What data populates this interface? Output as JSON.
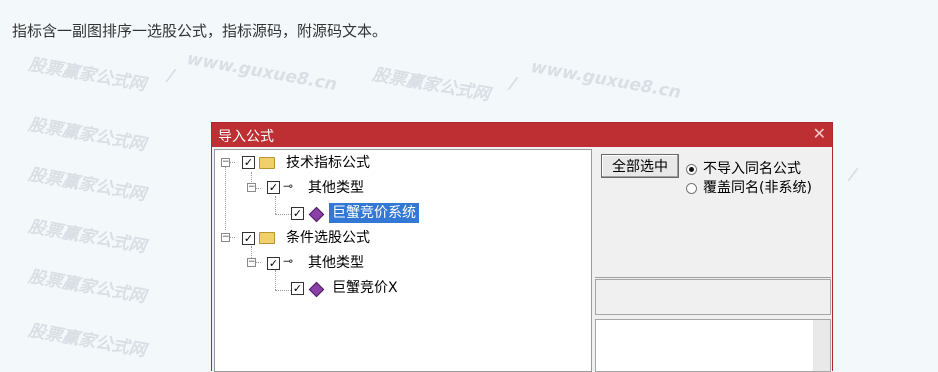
{
  "intro_text": "指标含一副图排序一选股公式，指标源码，附源码文本。",
  "watermark": {
    "brand": "股票赢家公式网",
    "slash": "/",
    "url": "www.guxue8.cn"
  },
  "dialog": {
    "title": "导入公式",
    "close_glyph": "✕",
    "tree": [
      {
        "label": "技术指标公式",
        "level": 0,
        "icon": "folder-icon",
        "checked": true,
        "expander": "−"
      },
      {
        "label": "其他类型",
        "level": 1,
        "icon": "key-icon",
        "checked": true,
        "expander": "−"
      },
      {
        "label": "巨蟹竞价系统",
        "level": 2,
        "icon": "gem-icon",
        "checked": true,
        "selected": true
      },
      {
        "label": "条件选股公式",
        "level": 0,
        "icon": "folder-icon",
        "checked": true,
        "expander": "−"
      },
      {
        "label": "其他类型",
        "level": 1,
        "icon": "key-icon",
        "checked": true,
        "expander": "−"
      },
      {
        "label": "巨蟹竞价X",
        "level": 2,
        "icon": "gem-icon",
        "checked": true
      }
    ],
    "select_all_label": "全部选中",
    "options": [
      {
        "label": "不导入同名公式",
        "selected": true
      },
      {
        "label": "覆盖同名(非系统)",
        "selected": false
      }
    ],
    "colors": {
      "titlebar": "#be2f33",
      "selection": "#3378d4"
    }
  }
}
